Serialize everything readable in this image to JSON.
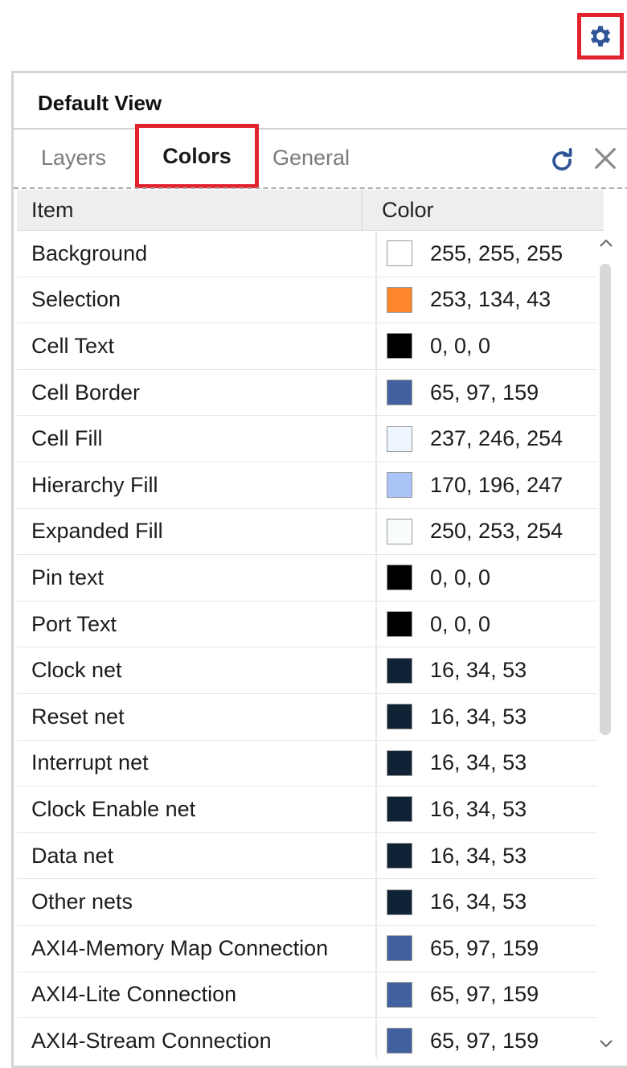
{
  "panel": {
    "title": "Default View",
    "tabs": [
      {
        "label": "Layers"
      },
      {
        "label": "Colors"
      },
      {
        "label": "General"
      }
    ]
  },
  "icons": {
    "settings": "gear-icon",
    "refresh": "refresh-icon",
    "close": "close-icon"
  },
  "table": {
    "headers": {
      "item": "Item",
      "color": "Color"
    },
    "rows": [
      {
        "item": "Background",
        "color": "255, 255, 255",
        "hex": "#ffffff"
      },
      {
        "item": "Selection",
        "color": "253, 134, 43",
        "hex": "#fd862b"
      },
      {
        "item": "Cell Text",
        "color": "0, 0, 0",
        "hex": "#000000"
      },
      {
        "item": "Cell Border",
        "color": "65, 97, 159",
        "hex": "#41619f"
      },
      {
        "item": "Cell Fill",
        "color": "237, 246, 254",
        "hex": "#edf6fe"
      },
      {
        "item": "Hierarchy Fill",
        "color": "170, 196, 247",
        "hex": "#aac4f7"
      },
      {
        "item": "Expanded Fill",
        "color": "250, 253, 254",
        "hex": "#fafdfe"
      },
      {
        "item": "Pin text",
        "color": "0, 0, 0",
        "hex": "#000000"
      },
      {
        "item": "Port Text",
        "color": "0, 0, 0",
        "hex": "#000000"
      },
      {
        "item": "Clock net",
        "color": "16, 34, 53",
        "hex": "#102235"
      },
      {
        "item": "Reset net",
        "color": "16, 34, 53",
        "hex": "#102235"
      },
      {
        "item": "Interrupt net",
        "color": "16, 34, 53",
        "hex": "#102235"
      },
      {
        "item": "Clock Enable net",
        "color": "16, 34, 53",
        "hex": "#102235"
      },
      {
        "item": "Data net",
        "color": "16, 34, 53",
        "hex": "#102235"
      },
      {
        "item": "Other nets",
        "color": "16, 34, 53",
        "hex": "#102235"
      },
      {
        "item": "AXI4-Memory Map Connection",
        "color": "65, 97, 159",
        "hex": "#41619f"
      },
      {
        "item": "AXI4-Lite Connection",
        "color": "65, 97, 159",
        "hex": "#41619f"
      },
      {
        "item": "AXI4-Stream Connection",
        "color": "65, 97, 159",
        "hex": "#41619f"
      },
      {
        "item": "",
        "color": "",
        "hex": "#41619f"
      }
    ]
  },
  "colors": {
    "highlight": "#e2232e",
    "gear": "#2f5597",
    "refresh": "#2f5597"
  }
}
